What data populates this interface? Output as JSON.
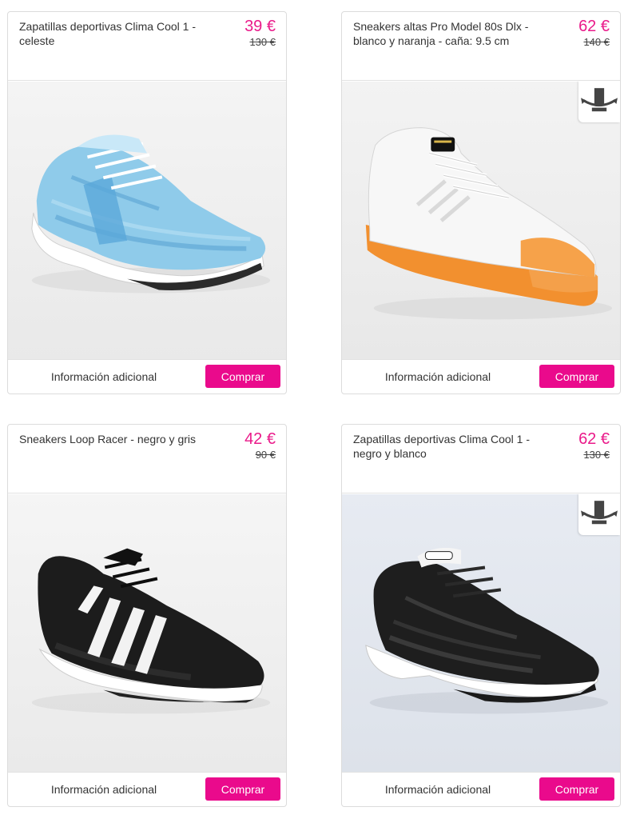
{
  "products": [
    {
      "title": "Zapatillas deportivas Clima Cool 1 - celeste",
      "price": "39 €",
      "old_price": "130 €",
      "image_alt": "light-blue-running-sneaker-image",
      "has_360_view": false,
      "info_label": "Información adicional",
      "buy_label": "Comprar"
    },
    {
      "title": "Sneakers altas Pro Model 80s Dlx - blanco y naranja - caña: 9.5 cm",
      "price": "62 €",
      "old_price": "140 €",
      "image_alt": "white-high-top-sneaker-orange-sole-image",
      "has_360_view": true,
      "info_label": "Información adicional",
      "buy_label": "Comprar"
    },
    {
      "title": "Sneakers Loop Racer - negro y gris",
      "price": "42 €",
      "old_price": "90 €",
      "image_alt": "black-striped-sneaker-image",
      "has_360_view": false,
      "info_label": "Información adicional",
      "buy_label": "Comprar"
    },
    {
      "title": "Zapatillas deportivas Clima Cool 1 - negro y blanco",
      "price": "62 €",
      "old_price": "130 €",
      "image_alt": "black-white-running-sneaker-image",
      "has_360_view": true,
      "info_label": "Información adicional",
      "buy_label": "Comprar"
    }
  ],
  "colors": {
    "price": "#ea1a8a",
    "buy_button": "#ea0a8c",
    "card_border": "#dcdcdc"
  },
  "icons": {
    "rotate": "360-view-icon"
  }
}
